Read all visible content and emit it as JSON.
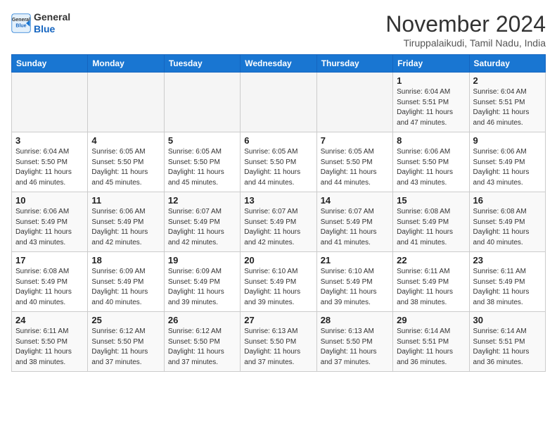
{
  "header": {
    "logo_line1": "General",
    "logo_line2": "Blue",
    "month_title": "November 2024",
    "subtitle": "Tiruppalaikudi, Tamil Nadu, India"
  },
  "calendar": {
    "days_of_week": [
      "Sunday",
      "Monday",
      "Tuesday",
      "Wednesday",
      "Thursday",
      "Friday",
      "Saturday"
    ],
    "weeks": [
      [
        {
          "day": "",
          "info": ""
        },
        {
          "day": "",
          "info": ""
        },
        {
          "day": "",
          "info": ""
        },
        {
          "day": "",
          "info": ""
        },
        {
          "day": "",
          "info": ""
        },
        {
          "day": "1",
          "info": "Sunrise: 6:04 AM\nSunset: 5:51 PM\nDaylight: 11 hours and 47 minutes."
        },
        {
          "day": "2",
          "info": "Sunrise: 6:04 AM\nSunset: 5:51 PM\nDaylight: 11 hours and 46 minutes."
        }
      ],
      [
        {
          "day": "3",
          "info": "Sunrise: 6:04 AM\nSunset: 5:50 PM\nDaylight: 11 hours and 46 minutes."
        },
        {
          "day": "4",
          "info": "Sunrise: 6:05 AM\nSunset: 5:50 PM\nDaylight: 11 hours and 45 minutes."
        },
        {
          "day": "5",
          "info": "Sunrise: 6:05 AM\nSunset: 5:50 PM\nDaylight: 11 hours and 45 minutes."
        },
        {
          "day": "6",
          "info": "Sunrise: 6:05 AM\nSunset: 5:50 PM\nDaylight: 11 hours and 44 minutes."
        },
        {
          "day": "7",
          "info": "Sunrise: 6:05 AM\nSunset: 5:50 PM\nDaylight: 11 hours and 44 minutes."
        },
        {
          "day": "8",
          "info": "Sunrise: 6:06 AM\nSunset: 5:50 PM\nDaylight: 11 hours and 43 minutes."
        },
        {
          "day": "9",
          "info": "Sunrise: 6:06 AM\nSunset: 5:49 PM\nDaylight: 11 hours and 43 minutes."
        }
      ],
      [
        {
          "day": "10",
          "info": "Sunrise: 6:06 AM\nSunset: 5:49 PM\nDaylight: 11 hours and 43 minutes."
        },
        {
          "day": "11",
          "info": "Sunrise: 6:06 AM\nSunset: 5:49 PM\nDaylight: 11 hours and 42 minutes."
        },
        {
          "day": "12",
          "info": "Sunrise: 6:07 AM\nSunset: 5:49 PM\nDaylight: 11 hours and 42 minutes."
        },
        {
          "day": "13",
          "info": "Sunrise: 6:07 AM\nSunset: 5:49 PM\nDaylight: 11 hours and 42 minutes."
        },
        {
          "day": "14",
          "info": "Sunrise: 6:07 AM\nSunset: 5:49 PM\nDaylight: 11 hours and 41 minutes."
        },
        {
          "day": "15",
          "info": "Sunrise: 6:08 AM\nSunset: 5:49 PM\nDaylight: 11 hours and 41 minutes."
        },
        {
          "day": "16",
          "info": "Sunrise: 6:08 AM\nSunset: 5:49 PM\nDaylight: 11 hours and 40 minutes."
        }
      ],
      [
        {
          "day": "17",
          "info": "Sunrise: 6:08 AM\nSunset: 5:49 PM\nDaylight: 11 hours and 40 minutes."
        },
        {
          "day": "18",
          "info": "Sunrise: 6:09 AM\nSunset: 5:49 PM\nDaylight: 11 hours and 40 minutes."
        },
        {
          "day": "19",
          "info": "Sunrise: 6:09 AM\nSunset: 5:49 PM\nDaylight: 11 hours and 39 minutes."
        },
        {
          "day": "20",
          "info": "Sunrise: 6:10 AM\nSunset: 5:49 PM\nDaylight: 11 hours and 39 minutes."
        },
        {
          "day": "21",
          "info": "Sunrise: 6:10 AM\nSunset: 5:49 PM\nDaylight: 11 hours and 39 minutes."
        },
        {
          "day": "22",
          "info": "Sunrise: 6:11 AM\nSunset: 5:49 PM\nDaylight: 11 hours and 38 minutes."
        },
        {
          "day": "23",
          "info": "Sunrise: 6:11 AM\nSunset: 5:49 PM\nDaylight: 11 hours and 38 minutes."
        }
      ],
      [
        {
          "day": "24",
          "info": "Sunrise: 6:11 AM\nSunset: 5:50 PM\nDaylight: 11 hours and 38 minutes."
        },
        {
          "day": "25",
          "info": "Sunrise: 6:12 AM\nSunset: 5:50 PM\nDaylight: 11 hours and 37 minutes."
        },
        {
          "day": "26",
          "info": "Sunrise: 6:12 AM\nSunset: 5:50 PM\nDaylight: 11 hours and 37 minutes."
        },
        {
          "day": "27",
          "info": "Sunrise: 6:13 AM\nSunset: 5:50 PM\nDaylight: 11 hours and 37 minutes."
        },
        {
          "day": "28",
          "info": "Sunrise: 6:13 AM\nSunset: 5:50 PM\nDaylight: 11 hours and 37 minutes."
        },
        {
          "day": "29",
          "info": "Sunrise: 6:14 AM\nSunset: 5:51 PM\nDaylight: 11 hours and 36 minutes."
        },
        {
          "day": "30",
          "info": "Sunrise: 6:14 AM\nSunset: 5:51 PM\nDaylight: 11 hours and 36 minutes."
        }
      ]
    ]
  }
}
